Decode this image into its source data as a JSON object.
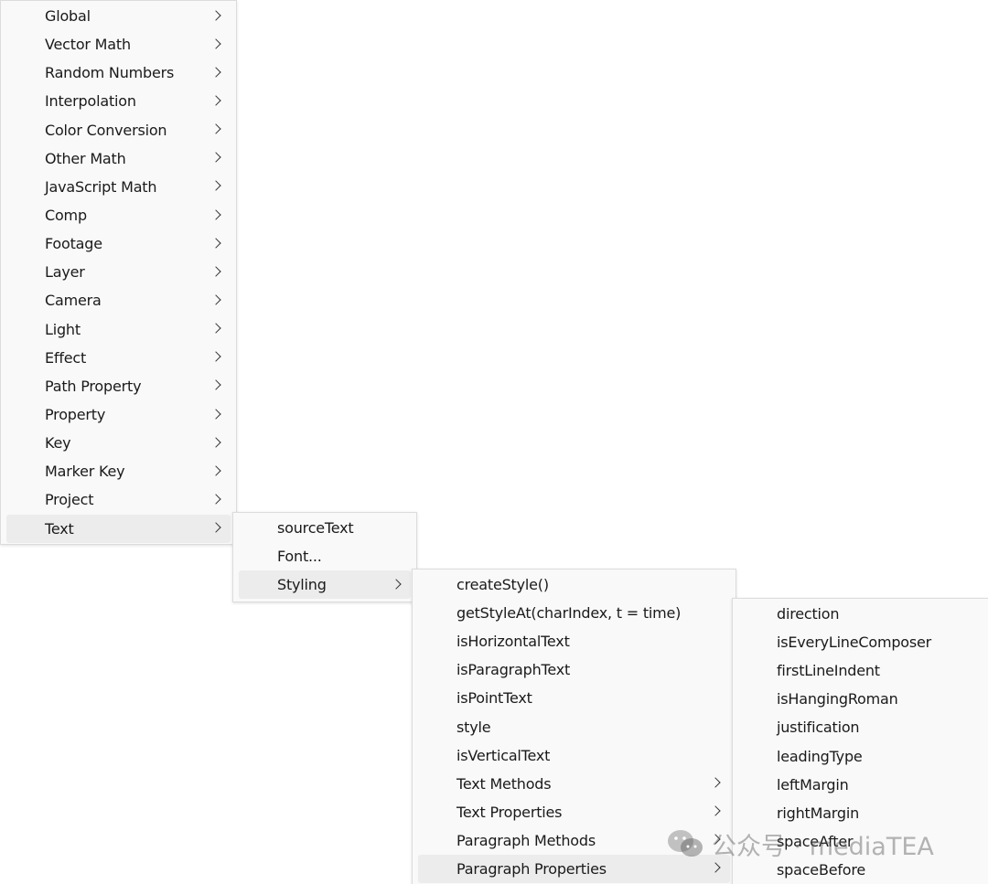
{
  "menu_main": [
    {
      "label": "Global",
      "submenu": true
    },
    {
      "label": "Vector Math",
      "submenu": true
    },
    {
      "label": "Random Numbers",
      "submenu": true
    },
    {
      "label": "Interpolation",
      "submenu": true
    },
    {
      "label": "Color Conversion",
      "submenu": true
    },
    {
      "label": "Other Math",
      "submenu": true
    },
    {
      "label": "JavaScript Math",
      "submenu": true
    },
    {
      "label": "Comp",
      "submenu": true
    },
    {
      "label": "Footage",
      "submenu": true
    },
    {
      "label": "Layer",
      "submenu": true
    },
    {
      "label": "Camera",
      "submenu": true
    },
    {
      "label": "Light",
      "submenu": true
    },
    {
      "label": "Effect",
      "submenu": true
    },
    {
      "label": "Path Property",
      "submenu": true
    },
    {
      "label": "Property",
      "submenu": true
    },
    {
      "label": "Key",
      "submenu": true
    },
    {
      "label": "Marker Key",
      "submenu": true
    },
    {
      "label": "Project",
      "submenu": true
    },
    {
      "label": "Text",
      "submenu": true,
      "active": true
    }
  ],
  "menu_text": [
    {
      "label": "sourceText",
      "submenu": false
    },
    {
      "label": "Font...",
      "submenu": false
    },
    {
      "label": "Styling",
      "submenu": true,
      "active": true
    }
  ],
  "menu_styling": [
    {
      "label": "createStyle()",
      "submenu": false
    },
    {
      "label": "getStyleAt(charIndex, t = time)",
      "submenu": false
    },
    {
      "label": "isHorizontalText",
      "submenu": false
    },
    {
      "label": "isParagraphText",
      "submenu": false
    },
    {
      "label": "isPointText",
      "submenu": false
    },
    {
      "label": "style",
      "submenu": false
    },
    {
      "label": "isVerticalText",
      "submenu": false
    },
    {
      "label": "Text Methods",
      "submenu": true
    },
    {
      "label": "Text Properties",
      "submenu": true
    },
    {
      "label": "Paragraph Methods",
      "submenu": true
    },
    {
      "label": "Paragraph Properties",
      "submenu": true,
      "active": true
    }
  ],
  "menu_paragraph_properties": [
    {
      "label": "direction",
      "submenu": false
    },
    {
      "label": "isEveryLineComposer",
      "submenu": false
    },
    {
      "label": "firstLineIndent",
      "submenu": false
    },
    {
      "label": "isHangingRoman",
      "submenu": false
    },
    {
      "label": "justification",
      "submenu": false
    },
    {
      "label": "leadingType",
      "submenu": false
    },
    {
      "label": "leftMargin",
      "submenu": false
    },
    {
      "label": "rightMargin",
      "submenu": false
    },
    {
      "label": "spaceAfter",
      "submenu": false
    },
    {
      "label": "spaceBefore",
      "submenu": false
    }
  ],
  "watermark": {
    "text": "公众号 · mediaTEA",
    "icon": "wechat-icon"
  },
  "colors": {
    "menu_bg": "#f9f9f9",
    "active_bg": "#ececec",
    "border": "#dcdcdc",
    "text": "#1a1a1a"
  }
}
